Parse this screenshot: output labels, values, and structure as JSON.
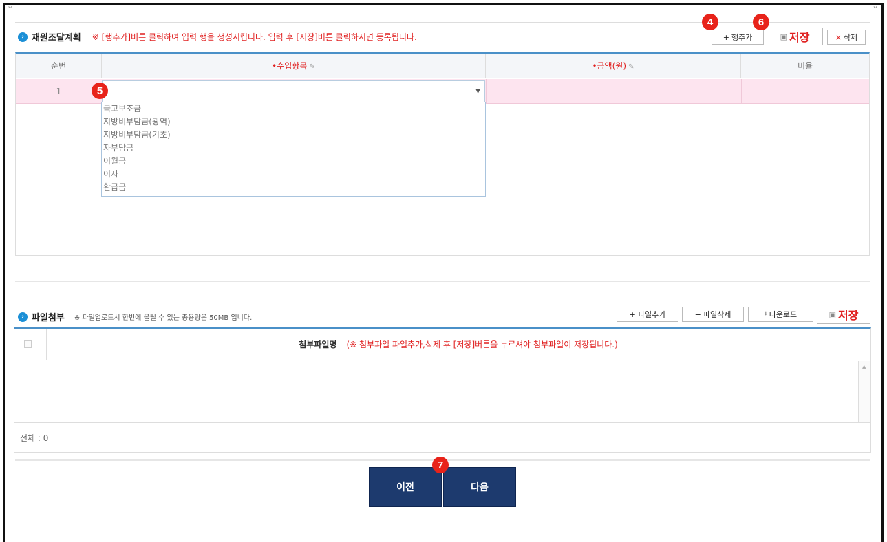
{
  "section1": {
    "title": "재원조달계획",
    "notice": "※ [행추가]버튼 클릭하여 입력 행을 생성시킵니다. 입력 후 [저장]버튼 클릭하시면 등록됩니다.",
    "buttons": {
      "add_row": "행추가",
      "save": "저장",
      "delete": "삭제"
    },
    "columns": [
      "순번",
      "•수입항목",
      "•금액(원)",
      "비율"
    ],
    "rows": [
      {
        "num": "1"
      }
    ],
    "dropdown_options": [
      "국고보조금",
      "지방비부담금(광역)",
      "지방비부담금(기초)",
      "자부담금",
      "이월금",
      "이자",
      "환급금"
    ]
  },
  "section2": {
    "title": "파일첨부",
    "notice": "※ 파일업로드시 한번에 올릴 수 있는 총용량은 50MB 입니다.",
    "buttons": {
      "add_file": "파일추가",
      "delete_file": "파일삭제",
      "download": "다운로드",
      "save": "저장"
    },
    "header_label": "첨부파일명",
    "header_notice": "(※ 첨부파일 파일추가,삭제 후 [저장]버튼을 누르셔야 첨부파일이 저장됩니다.)",
    "total": "전체 : 0"
  },
  "nav": {
    "prev": "이전",
    "next": "다음"
  },
  "badges": {
    "b4": "4",
    "b5": "5",
    "b6": "6",
    "b7": "7"
  },
  "colors": {
    "accent_blue": "#4a90c8",
    "nav_button": "#1d3a6e",
    "badge_red": "#e8231a",
    "row_highlight": "#fde4ef",
    "notice_red": "#e02020"
  }
}
